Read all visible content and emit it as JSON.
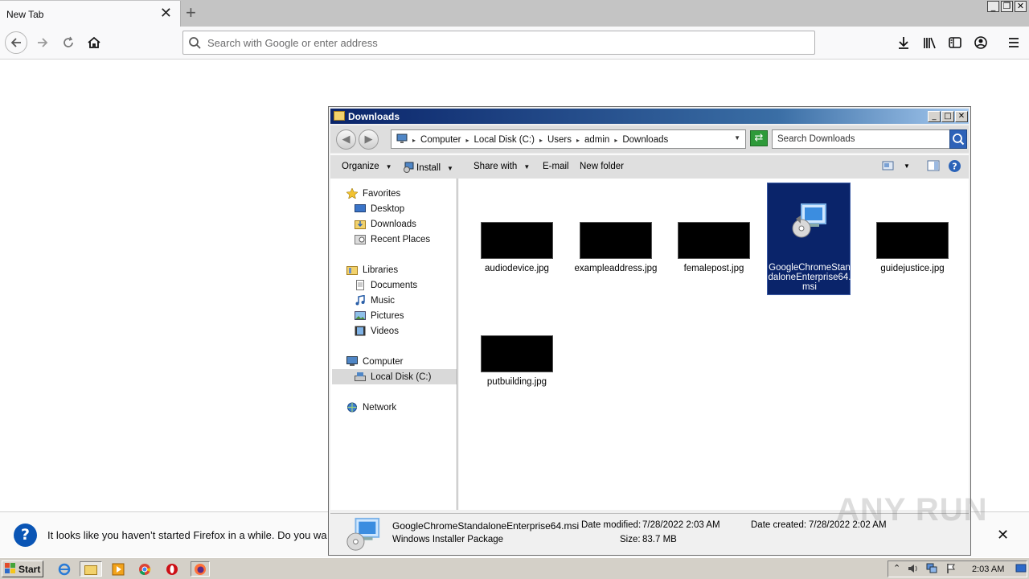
{
  "browser": {
    "tab_title": "New Tab",
    "url_placeholder": "Search with Google or enter address",
    "notification": "It looks like you haven’t started Firefox in a while. Do you wa"
  },
  "explorer": {
    "title": "Downloads",
    "breadcrumbs": [
      "Computer",
      "Local Disk (C:)",
      "Users",
      "admin",
      "Downloads"
    ],
    "search_placeholder": "Search Downloads",
    "toolbar": {
      "organize": "Organize",
      "install": "Install",
      "share_with": "Share with",
      "email": "E-mail",
      "new_folder": "New folder"
    },
    "nav": {
      "favorites": "Favorites",
      "desktop": "Desktop",
      "downloads": "Downloads",
      "recent_places": "Recent Places",
      "libraries": "Libraries",
      "documents": "Documents",
      "music": "Music",
      "pictures": "Pictures",
      "videos": "Videos",
      "computer": "Computer",
      "local_disk": "Local Disk (C:)",
      "network": "Network"
    },
    "files": [
      {
        "name": "audiodevice.jpg",
        "selected": false
      },
      {
        "name": "exampleaddress.jpg",
        "selected": false
      },
      {
        "name": "femalepost.jpg",
        "selected": false
      },
      {
        "name": "GoogleChromeStandaloneEnterprise64.msi",
        "selected": true
      },
      {
        "name": "guidejustice.jpg",
        "selected": false
      },
      {
        "name": "putbuilding.jpg",
        "selected": false
      }
    ],
    "details": {
      "filename": "GoogleChromeStandaloneEnterprise64.msi",
      "type": "Windows Installer Package",
      "modified_label": "Date modified:",
      "modified_value": "7/28/2022 2:03 AM",
      "size_label": "Size:",
      "size_value": "83.7 MB",
      "created_label": "Date created:",
      "created_value": "7/28/2022 2:02 AM"
    }
  },
  "taskbar": {
    "start_label": "Start",
    "clock": "2:03 AM"
  },
  "watermark": "ANY RUN",
  "colors": {
    "selection": "#0a246a",
    "taskbar": "#d4d0c8",
    "notice_icon": "#0a55b5"
  }
}
